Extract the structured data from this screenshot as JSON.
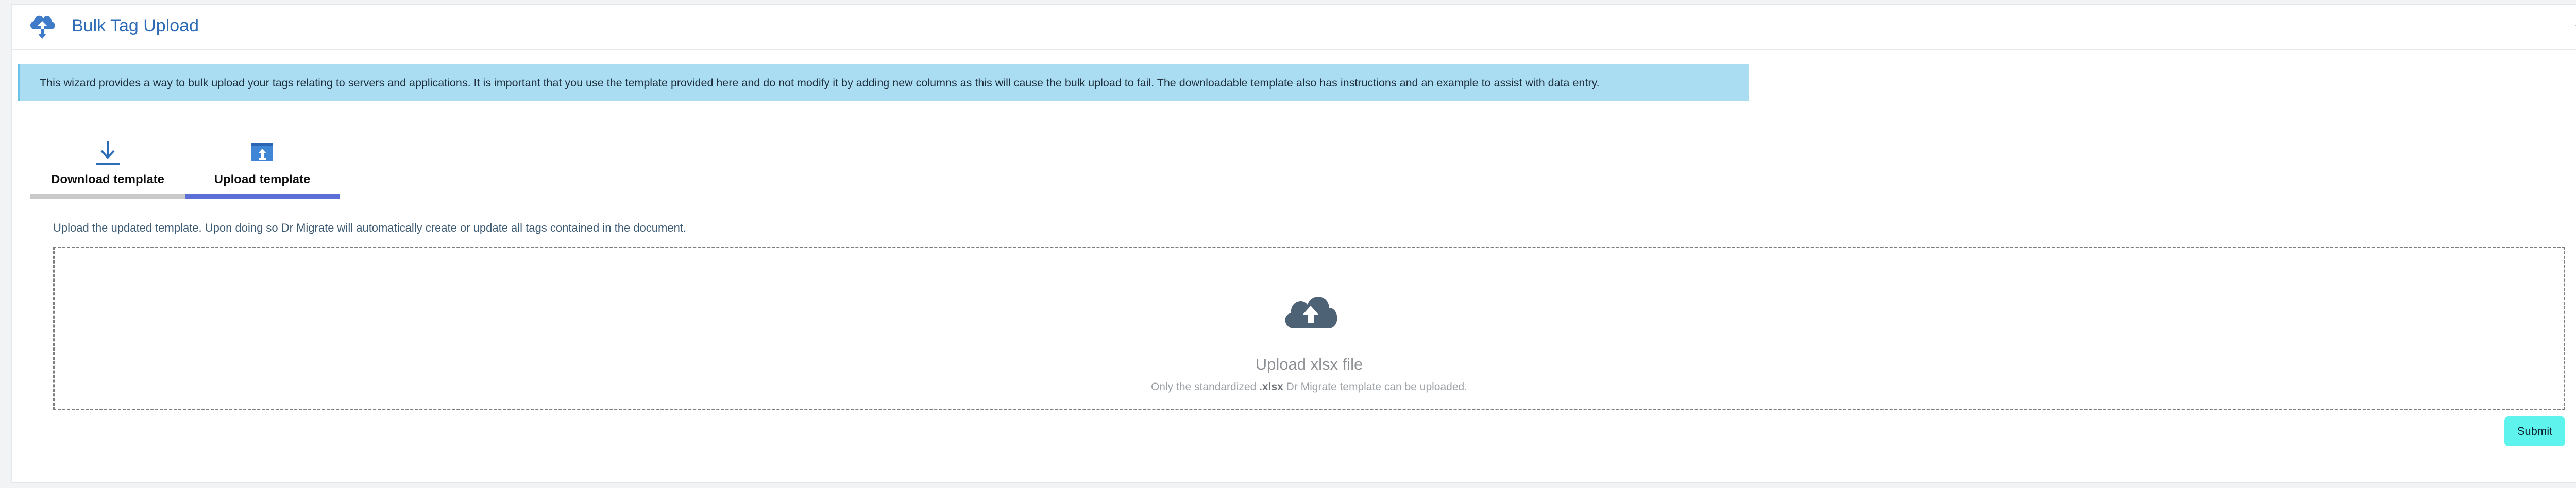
{
  "header": {
    "title": "Bulk Tag Upload",
    "icon": "cloud-upload-icon",
    "move_icon": "move-arrows-icon",
    "accent_color": "#2e6cb8"
  },
  "banner": {
    "text": "This wizard provides a way to bulk upload your tags relating to servers and applications. It is important that you use the template provided here and do not modify it by adding new columns as this will cause the bulk upload to fail. The downloadable template also has instructions and an example to assist with data entry.",
    "background": "#aadcf2"
  },
  "steps": [
    {
      "label": "Download template",
      "icon": "download-icon",
      "active": false
    },
    {
      "label": "Upload template",
      "icon": "upload-file-icon",
      "active": true
    }
  ],
  "upload": {
    "instruction": "Upload the updated template. Upon doing so Dr Migrate will automatically create or update all tags contained in the document.",
    "drop_title": "Upload xlsx file",
    "drop_sub_prefix": "Only the standardized ",
    "drop_sub_ext": ".xlsx",
    "drop_sub_suffix": " Dr Migrate template can be uploaded.",
    "icon": "cloud-upload-icon"
  },
  "actions": {
    "submit_label": "Submit",
    "submit_color": "#5ff3ee"
  }
}
